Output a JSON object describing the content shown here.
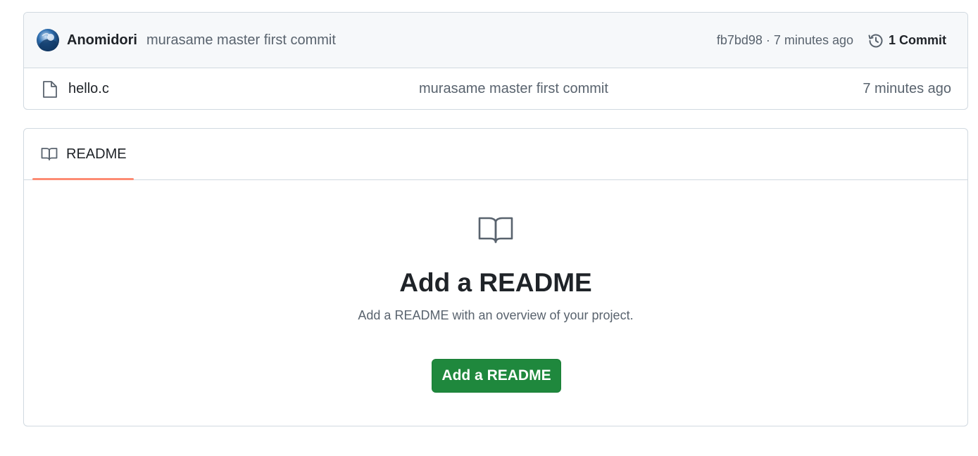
{
  "commit_bar": {
    "author": "Anomidori",
    "message": "murasame master first commit",
    "hash": "fb7bd98",
    "separator": " · ",
    "age": "7 minutes ago",
    "commit_count_label": "1 Commit"
  },
  "files": [
    {
      "name": "hello.c",
      "icon": "file-icon",
      "last_commit": "murasame master first commit",
      "age": "7 minutes ago"
    }
  ],
  "readme": {
    "tab_label": "README",
    "tab_icon": "book-icon",
    "empty_icon": "book-icon",
    "empty_title": "Add a README",
    "empty_description": "Add a README with an overview of your project.",
    "button_label": "Add a README"
  },
  "colors": {
    "button_green": "#1f883d",
    "tab_underline": "#fd8c73",
    "muted_text": "#59636e",
    "border": "#d1d9e0"
  }
}
